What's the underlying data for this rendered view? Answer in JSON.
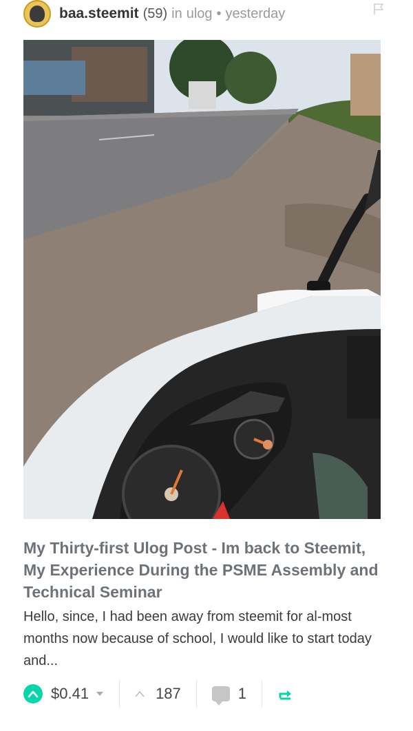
{
  "post": {
    "author": "baa.steemit",
    "reputation": "(59)",
    "community_prefix": "in",
    "community": "ulog",
    "separator": "•",
    "time": "yesterday",
    "title": "My Thirty-first Ulog Post - Im back to Steemit, My Experience During the PSME Assembly and Technical Seminar",
    "excerpt": "Hello, since, I had been away from steemit for al-most months now because of school, I would like to start today and..."
  },
  "footer": {
    "payout": "$0.41",
    "votes": "187",
    "comments": "1"
  },
  "icons": {
    "avatar": "avatar-icon",
    "flag": "flag-icon",
    "upvote": "upvote-icon",
    "payout_dropdown": "chevron-down-icon",
    "votes": "chevron-up-icon",
    "comments": "comment-icon",
    "resteem": "resteem-icon"
  },
  "colors": {
    "upvote_accent": "#06d6a9",
    "title": "#6d7279",
    "meta": "#9a9a9a"
  }
}
